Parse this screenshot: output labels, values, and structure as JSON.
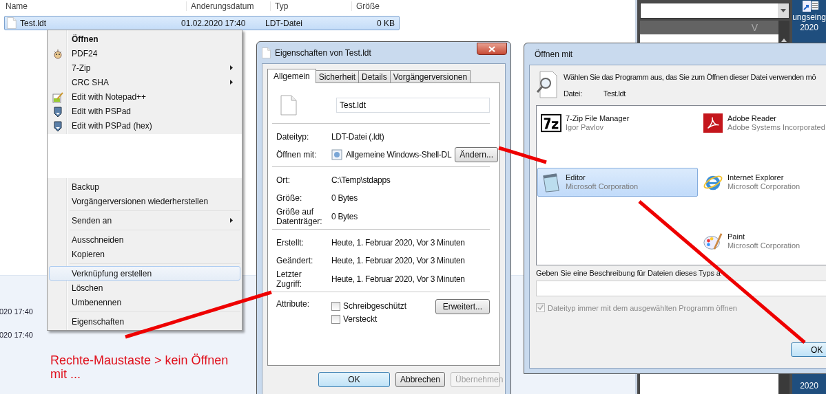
{
  "explorer": {
    "columns": [
      "Name",
      "Anderungsdatum",
      "Typ",
      "Größe"
    ],
    "files": [
      {
        "name": "Test.ldt",
        "modified": "01.02.2020 17:40",
        "type": "LDT-Datei",
        "size": "0 KB",
        "selected": true
      }
    ],
    "detail_times": [
      "020 17:40",
      "020 17:40"
    ]
  },
  "background_window": {
    "column_header": "V"
  },
  "desktop": {
    "icon_label": [
      "ungseing",
      "2020"
    ],
    "bottom_label": "2020"
  },
  "context_menu": {
    "items": [
      {
        "kind": "item",
        "label": "Öffnen",
        "bold": true,
        "submenu": false,
        "highlighted": false
      },
      {
        "kind": "item",
        "label": "PDF24",
        "bold": false,
        "submenu": false,
        "highlighted": false
      },
      {
        "kind": "item",
        "label": "7-Zip",
        "bold": false,
        "submenu": true,
        "highlighted": false
      },
      {
        "kind": "item",
        "label": "CRC SHA",
        "bold": false,
        "submenu": true,
        "highlighted": false
      },
      {
        "kind": "item",
        "label": "Edit with Notepad++",
        "bold": false,
        "submenu": false,
        "highlighted": false
      },
      {
        "kind": "item",
        "label": "Edit with PSPad",
        "bold": false,
        "submenu": false,
        "highlighted": false
      },
      {
        "kind": "item",
        "label": "Edit with PSPad (hex)",
        "bold": false,
        "submenu": false,
        "highlighted": false
      },
      {
        "kind": "blank"
      },
      {
        "kind": "item",
        "label": "Backup",
        "bold": false,
        "submenu": false,
        "highlighted": false
      },
      {
        "kind": "item",
        "label": "Vorgängerversionen wiederherstellen",
        "bold": false,
        "submenu": false,
        "highlighted": false
      },
      {
        "kind": "separator"
      },
      {
        "kind": "item",
        "label": "Senden an",
        "bold": false,
        "submenu": true,
        "highlighted": false
      },
      {
        "kind": "separator"
      },
      {
        "kind": "item",
        "label": "Ausschneiden",
        "bold": false,
        "submenu": false,
        "highlighted": false
      },
      {
        "kind": "item",
        "label": "Kopieren",
        "bold": false,
        "submenu": false,
        "highlighted": false
      },
      {
        "kind": "separator"
      },
      {
        "kind": "item",
        "label": "Verknüpfung erstellen",
        "bold": false,
        "submenu": false,
        "highlighted": true
      },
      {
        "kind": "item",
        "label": "Löschen",
        "bold": false,
        "submenu": false,
        "highlighted": false
      },
      {
        "kind": "item",
        "label": "Umbenennen",
        "bold": false,
        "submenu": false,
        "highlighted": false
      },
      {
        "kind": "separator"
      },
      {
        "kind": "item",
        "label": "Eigenschaften",
        "bold": false,
        "submenu": false,
        "highlighted": false
      }
    ]
  },
  "annotation": "Rechte-Maustaste > kein Öffnen mit ...",
  "properties_dialog": {
    "title": "Eigenschaften von Test.ldt",
    "tabs": [
      {
        "label": "Allgemein",
        "selected": true
      },
      {
        "label": "Sicherheit",
        "selected": false
      },
      {
        "label": "Details",
        "selected": false
      },
      {
        "label": "Vorgängerversionen",
        "selected": false
      }
    ],
    "file_name": "Test.ldt",
    "sections": [
      [
        {
          "label": "Dateityp:",
          "value": "LDT-Datei (.ldt)"
        },
        {
          "label": "Öffnen mit:",
          "value": "Allgemeine Windows-Shell-DL",
          "button": "Ändern..."
        }
      ],
      [
        {
          "label": "Ort:",
          "value": "C:\\Temp\\stdapps"
        },
        {
          "label": "Größe:",
          "value": "0 Bytes"
        },
        {
          "label": "Größe auf Datenträger:",
          "value": "0 Bytes"
        }
      ],
      [
        {
          "label": "Erstellt:",
          "value": "Heute, 1. Februar 2020, Vor 3 Minuten"
        },
        {
          "label": "Geändert:",
          "value": "Heute, 1. Februar 2020, Vor 3 Minuten"
        },
        {
          "label": "Letzter Zugriff:",
          "value": "Heute, 1. Februar 2020, Vor 3 Minuten"
        }
      ]
    ],
    "attributes": {
      "label": "Attribute:",
      "options": [
        {
          "label": "Schreibgeschützt",
          "checked": false
        },
        {
          "label": "Versteckt",
          "checked": false
        }
      ],
      "button": "Erweitert..."
    },
    "buttons": [
      {
        "label": "OK",
        "disabled": false
      },
      {
        "label": "Abbrechen",
        "disabled": false
      },
      {
        "label": "Übernehmen",
        "disabled": true
      }
    ]
  },
  "open_with_dialog": {
    "title": "Öffnen mit",
    "instruction": "Wählen Sie das Programm aus, das Sie zum Öffnen dieser Datei verwenden mö",
    "file_label": "Datei:",
    "file_name": "Test.ldt",
    "programs": [
      {
        "kind": "program",
        "name": "7-Zip File Manager",
        "publisher": "Igor Pavlov",
        "selected": false
      },
      {
        "kind": "program",
        "name": "Adobe Reader",
        "publisher": "Adobe Systems Incorporated",
        "selected": false
      },
      {
        "kind": "program",
        "name": "Editor",
        "publisher": "Microsoft Corporation",
        "selected": true
      },
      {
        "kind": "program",
        "name": "Internet Explorer",
        "publisher": "Microsoft Corporation",
        "selected": false
      },
      {
        "kind": "empty"
      },
      {
        "kind": "program",
        "name": "Paint",
        "publisher": "Microsoft Corporation",
        "selected": false
      }
    ],
    "description_label": "Geben Sie eine Beschreibung für Dateien dieses Typs a",
    "always_use": {
      "label": "Dateityp immer mit dem ausgewählten Programm öffnen",
      "checked": true,
      "disabled": true
    },
    "ok_button": "OK"
  }
}
